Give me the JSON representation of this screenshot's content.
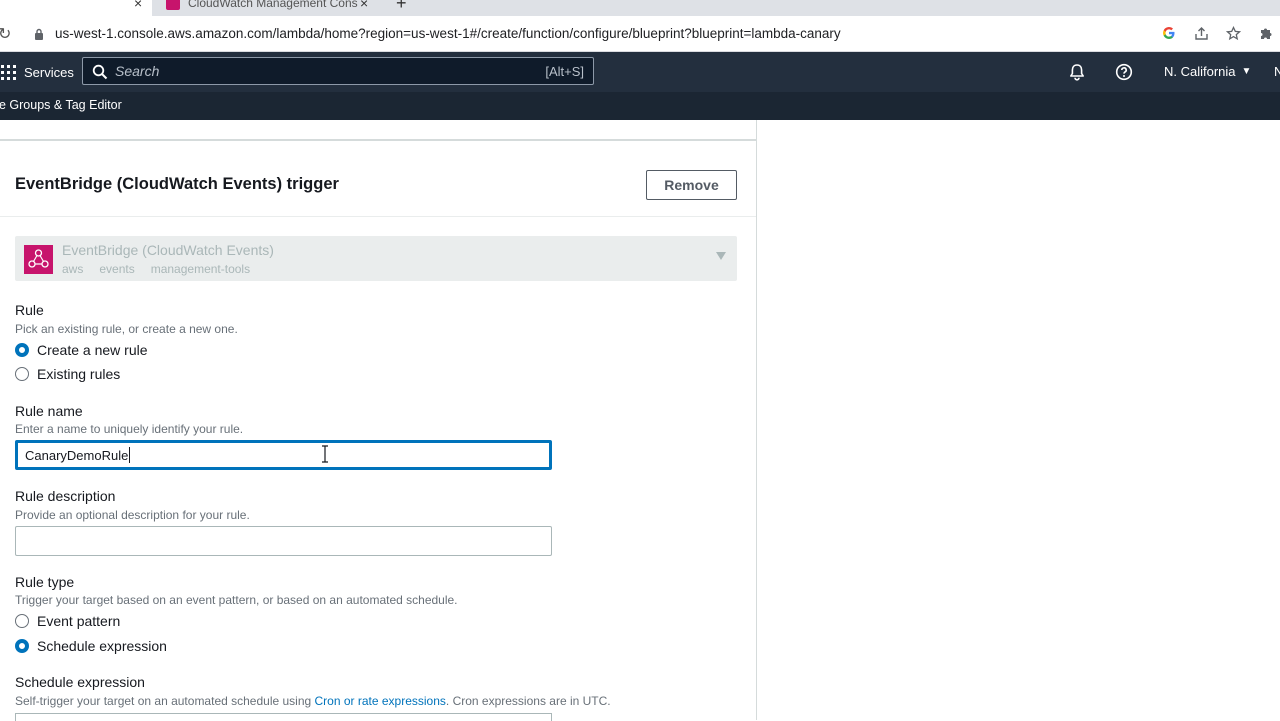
{
  "browser": {
    "tab2_title": "CloudWatch Management Console",
    "url": "us-west-1.console.aws.amazon.com/lambda/home?region=us-west-1#/create/function/configure/blueprint?blueprint=lambda-canary",
    "new_tab": "+",
    "close_glyph": "×"
  },
  "awsnav": {
    "services_label": "Services",
    "search_placeholder": "Search",
    "search_shortcut": "[Alt+S]",
    "region": "N. California",
    "region_caret": "▼",
    "right_fragment": "N"
  },
  "subnav": {
    "item": "e Groups & Tag Editor"
  },
  "trigger": {
    "title": "EventBridge (CloudWatch Events) trigger",
    "remove_label": "Remove",
    "service_name": "EventBridge (CloudWatch Events)",
    "service_tags": [
      "aws",
      "events",
      "management-tools"
    ]
  },
  "rule": {
    "label": "Rule",
    "description": "Pick an existing rule, or create a new one.",
    "options": [
      {
        "label": "Create a new rule",
        "checked": true
      },
      {
        "label": "Existing rules",
        "checked": false
      }
    ]
  },
  "rule_name": {
    "label": "Rule name",
    "description": "Enter a name to uniquely identify your rule.",
    "value": "CanaryDemoRule"
  },
  "rule_description": {
    "label": "Rule description",
    "description": "Provide an optional description for your rule.",
    "value": ""
  },
  "rule_type": {
    "label": "Rule type",
    "description": "Trigger your target based on an event pattern, or based on an automated schedule.",
    "options": [
      {
        "label": "Event pattern",
        "checked": false
      },
      {
        "label": "Schedule expression",
        "checked": true
      }
    ]
  },
  "schedule_expression": {
    "label": "Schedule expression",
    "description_prefix": "Self-trigger your target on an automated schedule using ",
    "description_link": "Cron or rate expressions",
    "description_suffix": ". Cron expressions are in UTC."
  },
  "colors": {
    "aws_nav": "#232f3e",
    "accent_blue": "#0073bb",
    "eventbridge_pink": "#c7146c"
  }
}
